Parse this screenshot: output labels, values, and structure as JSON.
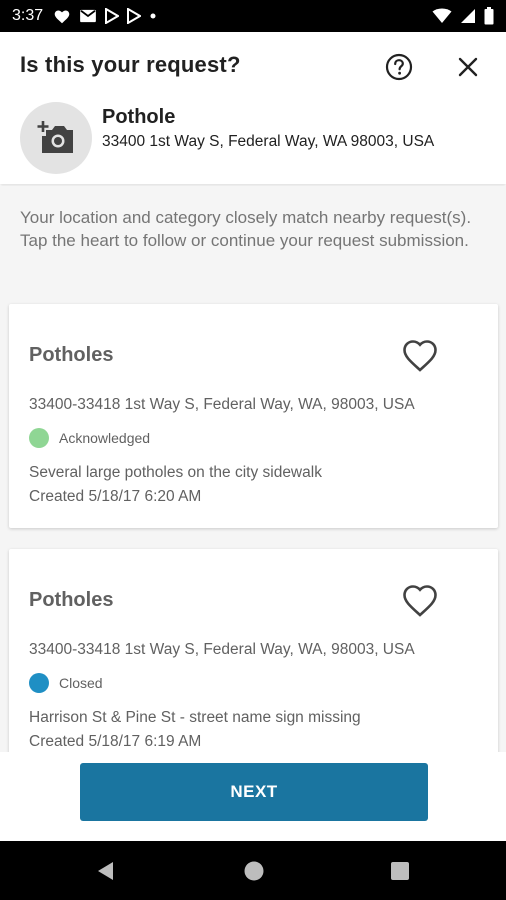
{
  "status_bar": {
    "time": "3:37",
    "left_icons": [
      "heart-icon",
      "mail-icon",
      "play-store-icon",
      "play-store-icon",
      "dot-icon"
    ],
    "right_icons": [
      "wifi-icon",
      "signal-icon",
      "battery-icon"
    ]
  },
  "header": {
    "title": "Is this your request?",
    "help_icon": "help-circle-icon",
    "close_icon": "close-icon",
    "category": {
      "icon": "add-photo-icon",
      "name": "Pothole",
      "address": "33400 1st Way S, Federal Way, WA 98003, USA"
    }
  },
  "intro_text": "Your location and category closely match nearby request(s). Tap the heart to follow or continue your request submission.",
  "requests": [
    {
      "title": "Potholes",
      "address": "33400-33418 1st Way S, Federal Way, WA, 98003, USA",
      "status": "Acknowledged",
      "status_color": "#8fd694",
      "description": "Several large potholes on the city sidewalk",
      "created": "Created 5/18/17 6:20 AM"
    },
    {
      "title": "Potholes",
      "address": "33400-33418 1st Way S, Federal Way, WA, 98003, USA",
      "status": "Closed",
      "status_color": "#1f8fc4",
      "description": "Harrison St & Pine St - street name sign missing",
      "created": "Created 5/18/17 6:19 AM"
    }
  ],
  "next_button": "NEXT",
  "colors": {
    "primary": "#1a75a0",
    "background": "#f5f5f5"
  }
}
